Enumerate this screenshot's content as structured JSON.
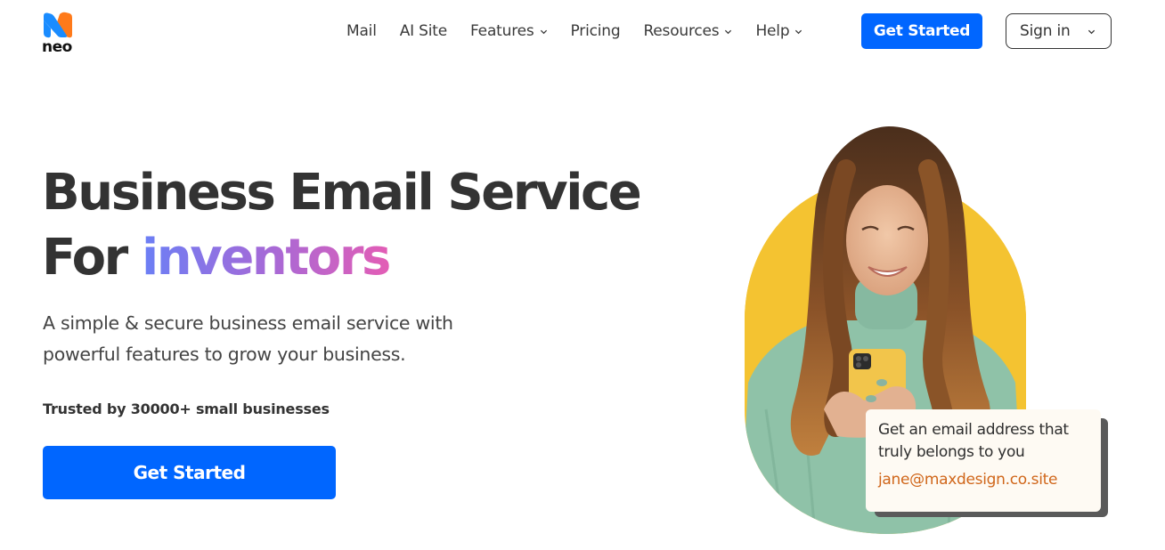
{
  "brand": {
    "name": "neo",
    "logo_icon": "neo-logo-icon",
    "colors": {
      "primary_blue": "#0066ff",
      "logo_blue": "#1a8cff",
      "logo_orange": "#ff7a1a",
      "gradient_start": "#6b7ff5",
      "gradient_end": "#e35db5",
      "arch_yellow": "#f4c331",
      "sweater_green": "#8fc2a8",
      "email_orange": "#d0661a"
    }
  },
  "nav": {
    "links": [
      {
        "label": "Mail",
        "has_dropdown": false
      },
      {
        "label": "AI Site",
        "has_dropdown": false
      },
      {
        "label": "Features",
        "has_dropdown": true
      },
      {
        "label": "Pricing",
        "has_dropdown": false
      },
      {
        "label": "Resources",
        "has_dropdown": true
      },
      {
        "label": "Help",
        "has_dropdown": true
      }
    ],
    "get_started_label": "Get Started",
    "sign_in_label": "Sign in"
  },
  "hero": {
    "title_line1": "Business Email Service",
    "title_line2_prefix": "For",
    "title_line2_highlight": "inventors",
    "subtitle": "A simple & secure business email service with powerful features to grow your business.",
    "trusted_text": "Trusted by 30000+ small businesses",
    "cta_label": "Get Started"
  },
  "illustration": {
    "description": "Smiling woman in green sweater holding yellow phone, on yellow arch background",
    "card": {
      "text": "Get an email address that truly belongs to you",
      "email": "jane@maxdesign.co.site"
    }
  }
}
